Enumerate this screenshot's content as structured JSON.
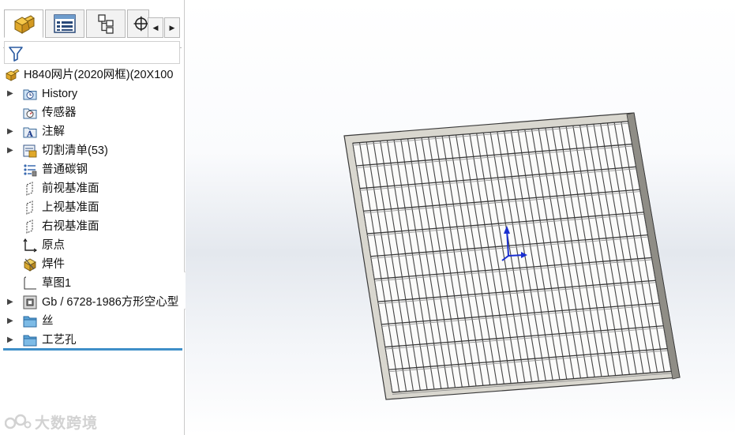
{
  "feature_manager": {
    "tabs": [
      {
        "name": "FeatureManager",
        "icon": "part-icon"
      },
      {
        "name": "PropertyManager",
        "icon": "property-icon"
      },
      {
        "name": "ConfigurationManager",
        "icon": "config-icon"
      },
      {
        "name": "DimXpertManager",
        "icon": "dimxpert-icon"
      }
    ],
    "filter_icon": "funnel-icon",
    "root": {
      "label": "H840网片(2020网框)(20X100",
      "icon": "part-icon"
    },
    "items": [
      {
        "label": "History",
        "icon": "history-folder-icon",
        "expandable": true
      },
      {
        "label": "传感器",
        "icon": "sensor-folder-icon",
        "expandable": false
      },
      {
        "label": "注解",
        "icon": "annotation-folder-icon",
        "expandable": true
      },
      {
        "label": "切割清单(53)",
        "icon": "cut-list-icon",
        "expandable": true
      },
      {
        "label": "普通碳钢",
        "icon": "material-icon",
        "expandable": false
      },
      {
        "label": "前视基准面",
        "icon": "plane-icon",
        "expandable": false
      },
      {
        "label": "上视基准面",
        "icon": "plane-icon",
        "expandable": false
      },
      {
        "label": "右视基准面",
        "icon": "plane-icon",
        "expandable": false
      },
      {
        "label": "原点",
        "icon": "origin-icon",
        "expandable": false
      },
      {
        "label": "焊件",
        "icon": "weldment-icon",
        "expandable": false
      },
      {
        "label": "草图1",
        "icon": "sketch-icon",
        "expandable": false
      },
      {
        "label": "Gb / 6728-1986方形空心型",
        "icon": "structural-member-icon",
        "expandable": true
      },
      {
        "label": "丝",
        "icon": "folder-icon",
        "expandable": true
      },
      {
        "label": "工艺孔",
        "icon": "folder-icon",
        "expandable": true
      }
    ]
  },
  "viewport": {
    "model": "wire-mesh-panel",
    "triad_colors": {
      "y": "#1a2fd0",
      "x": "#1a2fd0"
    }
  },
  "watermark": {
    "text": "大数跨境"
  },
  "colors": {
    "accent": "#3f8fc8",
    "icon_gold": "#e8b030",
    "folder_blue": "#5ba3d6"
  }
}
